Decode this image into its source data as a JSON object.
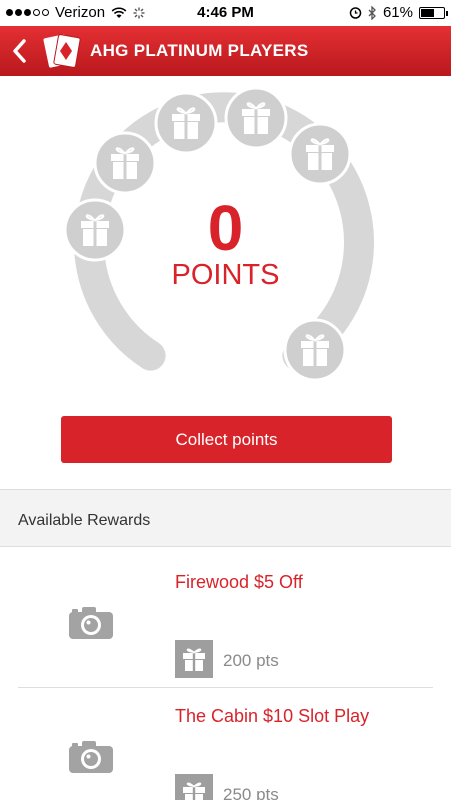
{
  "status_bar": {
    "carrier": "Verizon",
    "time": "4:46 PM",
    "battery": "61%",
    "battery_level": 0.61,
    "signal_bars_filled": 3,
    "signal_bars_total": 5
  },
  "navbar": {
    "title": "AHG PLATINUM PLAYERS",
    "back_icon": "chevron-left-icon",
    "logo_icon": "card-diamond-logo"
  },
  "points": {
    "value": "0",
    "label": "POINTS",
    "progress": 0
  },
  "collect_button": {
    "label": "Collect points"
  },
  "rewards": {
    "header": "Available Rewards",
    "items": [
      {
        "title": "Firewood $5 Off",
        "points": "200 pts"
      },
      {
        "title": "The Cabin $10 Slot Play",
        "points": "250 pts"
      }
    ]
  },
  "colors": {
    "accent": "#d9232a",
    "nav_gradient_top": "#e43033",
    "nav_gradient_bottom": "#b9181d",
    "arc_gray": "#d7d7d7",
    "gift_circle": "#cfcfcf"
  }
}
